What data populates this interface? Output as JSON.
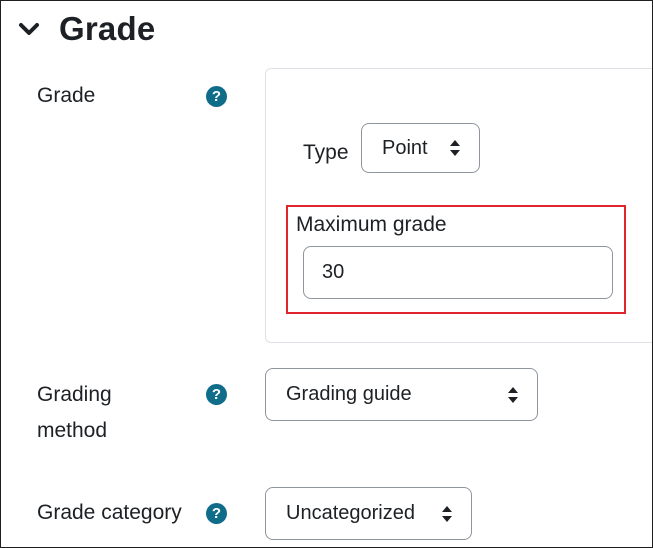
{
  "section": {
    "title": "Grade",
    "toggle_icon": "chevron-down-icon"
  },
  "grade": {
    "label": "Grade",
    "help_icon": "help-icon",
    "help_glyph": "?",
    "type": {
      "label": "Type",
      "selected": "Point"
    },
    "maximum_grade": {
      "label": "Maximum grade",
      "value": "30"
    }
  },
  "grading_method": {
    "label_line1": "Grading",
    "label_line2": "method",
    "help_glyph": "?",
    "selected": "Grading guide"
  },
  "grade_category": {
    "label": "Grade category",
    "help_glyph": "?",
    "selected": "Uncategorized"
  },
  "colors": {
    "help_icon": "#0f6d8a",
    "highlight_border": "#e0262c",
    "text": "#1d2125"
  }
}
